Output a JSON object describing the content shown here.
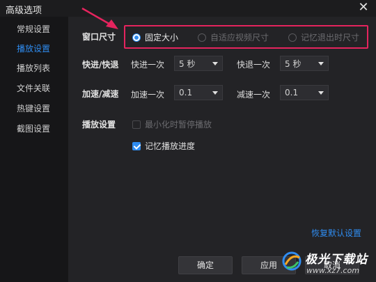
{
  "window": {
    "title": "高级选项"
  },
  "sidebar": {
    "items": [
      {
        "label": "常规设置",
        "active": false
      },
      {
        "label": "播放设置",
        "active": true
      },
      {
        "label": "播放列表",
        "active": false
      },
      {
        "label": "文件关联",
        "active": false
      },
      {
        "label": "热键设置",
        "active": false
      },
      {
        "label": "截图设置",
        "active": false
      }
    ]
  },
  "window_size": {
    "label": "窗口尺寸",
    "options": [
      {
        "label": "固定大小",
        "checked": true,
        "enabled": true
      },
      {
        "label": "自适应视频尺寸",
        "checked": false,
        "enabled": false
      },
      {
        "label": "记忆退出时尺寸",
        "checked": false,
        "enabled": false
      }
    ]
  },
  "seek": {
    "label": "快进/快退",
    "forward_label": "快进一次",
    "forward_value": "5 秒",
    "backward_label": "快退一次",
    "backward_value": "5 秒"
  },
  "speed": {
    "label": "加速/减速",
    "up_label": "加速一次",
    "up_value": "0.1",
    "down_label": "减速一次",
    "down_value": "0.1"
  },
  "playback": {
    "label": "播放设置",
    "pause_on_minimize": {
      "label": "最小化时暂停播放",
      "checked": false,
      "enabled": false
    },
    "remember_progress": {
      "label": "记忆播放进度",
      "checked": true,
      "enabled": true
    }
  },
  "restore_defaults": "恢复默认设置",
  "buttons": {
    "ok": "确定",
    "apply": "应用",
    "cancel": "取消"
  },
  "watermark": {
    "text": "极光下载站",
    "url": "www.xz7.com"
  },
  "colors": {
    "accent": "#2f8cf0",
    "highlight": "#e5245e",
    "background": "#232326"
  }
}
